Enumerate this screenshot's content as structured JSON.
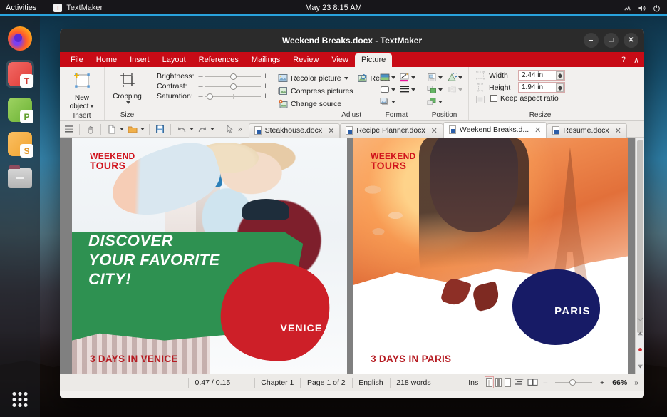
{
  "desktop": {
    "topbar": {
      "activities": "Activities",
      "app_name": "TextMaker",
      "app_badge": "T",
      "clock": "May 23  8:15 AM",
      "tray_icons": [
        "network-icon",
        "volume-icon",
        "power-icon"
      ]
    },
    "dock": {
      "items": [
        {
          "name": "firefox",
          "letter": ""
        },
        {
          "name": "textmaker",
          "letter": "T"
        },
        {
          "name": "planmaker",
          "letter": "P"
        },
        {
          "name": "presentations",
          "letter": "S"
        },
        {
          "name": "files",
          "letter": ""
        }
      ],
      "show_apps_label": "Show Applications"
    }
  },
  "window": {
    "title": "Weekend Breaks.docx - TextMaker",
    "controls": {
      "minimize": "–",
      "maximize": "□",
      "close": "✕"
    },
    "ribbon_tabs": [
      {
        "label": "File",
        "active": false
      },
      {
        "label": "Home",
        "active": false
      },
      {
        "label": "Insert",
        "active": false
      },
      {
        "label": "Layout",
        "active": false
      },
      {
        "label": "References",
        "active": false
      },
      {
        "label": "Mailings",
        "active": false
      },
      {
        "label": "Review",
        "active": false
      },
      {
        "label": "View",
        "active": false
      },
      {
        "label": "Picture",
        "active": true
      }
    ],
    "ribbon_right": {
      "help": "?",
      "collapse": "∧"
    }
  },
  "ribbon": {
    "insert_group": {
      "label": "Insert",
      "button_line1": "New",
      "button_line2": "object",
      "icon": "new-object-icon"
    },
    "size_group": {
      "label": "Size",
      "button": "Cropping",
      "icon": "crop-icon"
    },
    "adjust_group": {
      "label": "Adjust",
      "sliders": [
        {
          "label": "Brightness:",
          "minus": "–",
          "plus": "+",
          "value": 50
        },
        {
          "label": "Contrast:",
          "minus": "–",
          "plus": "+",
          "value": 50
        },
        {
          "label": "Saturation:",
          "minus": "–",
          "plus": "+",
          "value": 5
        }
      ],
      "commands": [
        {
          "label": "Recolor picture",
          "icon": "recolor-picture-icon",
          "has_dropdown": true
        },
        {
          "label": "Compress pictures",
          "icon": "compress-pictures-icon",
          "has_dropdown": false
        },
        {
          "label": "Change source",
          "icon": "change-source-icon",
          "has_dropdown": false
        },
        {
          "label": "Reset",
          "icon": "reset-picture-icon",
          "has_dropdown": false
        }
      ]
    },
    "format_group": {
      "label": "Format",
      "icons": [
        "fill-color-icon",
        "line-style-icon",
        "shadow-icon",
        "line-color-icon",
        "border-weight-icon"
      ]
    },
    "position_group": {
      "label": "Position",
      "icons": [
        "text-wrapping-icon",
        "rotate-icon",
        "bring-forward-icon",
        "flip-icon",
        "send-backward-icon"
      ]
    },
    "resize_group": {
      "label": "Resize",
      "width_label": "Width",
      "width_value": "2.44 in",
      "height_label": "Height",
      "height_value": "1.94 in",
      "keep_aspect_label": "Keep aspect ratio",
      "keep_aspect_checked": false,
      "side_icons": [
        "fit-to-frame-icon",
        "fit-height-icon",
        "fit-frame-icon"
      ]
    }
  },
  "doc_toolbar": {
    "buttons": [
      {
        "name": "sidebar-toggle",
        "icon": "list-icon"
      },
      {
        "name": "touch-mode",
        "icon": "hand-icon"
      },
      {
        "name": "new-document",
        "icon": "new-file-icon",
        "has_dropdown": true
      },
      {
        "name": "open-document",
        "icon": "folder-icon",
        "has_dropdown": true
      },
      {
        "name": "save-document",
        "icon": "save-icon"
      },
      {
        "name": "undo",
        "icon": "undo-icon",
        "has_dropdown": true
      },
      {
        "name": "redo",
        "icon": "redo-icon",
        "has_dropdown": true
      },
      {
        "name": "select-object",
        "icon": "cursor-icon"
      }
    ],
    "overflow": "»"
  },
  "doc_tabs": [
    {
      "label": "Steakhouse.docx",
      "active": false,
      "close": "✕"
    },
    {
      "label": "Recipe Planner.docx",
      "active": false,
      "close": "✕"
    },
    {
      "label": "Weekend Breaks.d...",
      "active": true,
      "close": "✕"
    },
    {
      "label": "Resume.docx",
      "active": false,
      "close": "✕"
    }
  ],
  "document": {
    "pages": [
      {
        "name": "venice-poster",
        "logo_line1": "WEEKEND",
        "logo_line2": "TOURS",
        "headline_lines": [
          "DISCOVER",
          "YOUR FAVORITE",
          "CITY!"
        ],
        "badge": "VENICE",
        "footer": "3 DAYS IN VENICE",
        "accent_color": "#2e9151",
        "badge_color": "#cd1f28"
      },
      {
        "name": "paris-poster",
        "logo_line1": "WEEKEND",
        "logo_line2": "TOURS",
        "headline_lines": [],
        "badge": "PARIS",
        "footer": "3 DAYS IN PARIS",
        "accent_color": "#e2703a",
        "badge_color": "#171b66"
      }
    ]
  },
  "statusbar": {
    "position": "0.47 / 0.15",
    "chapter": "Chapter 1",
    "page": "Page 1 of 2",
    "language": "English",
    "words": "218 words",
    "insert_mode": "Ins",
    "view_modes": [
      "print-layout-icon",
      "draft-view-icon",
      "page-view-icon",
      "continuous-view-icon",
      "book-view-icon"
    ],
    "zoom_out": "–",
    "zoom_in": "+",
    "zoom_level": "66%",
    "overflow": "»"
  }
}
